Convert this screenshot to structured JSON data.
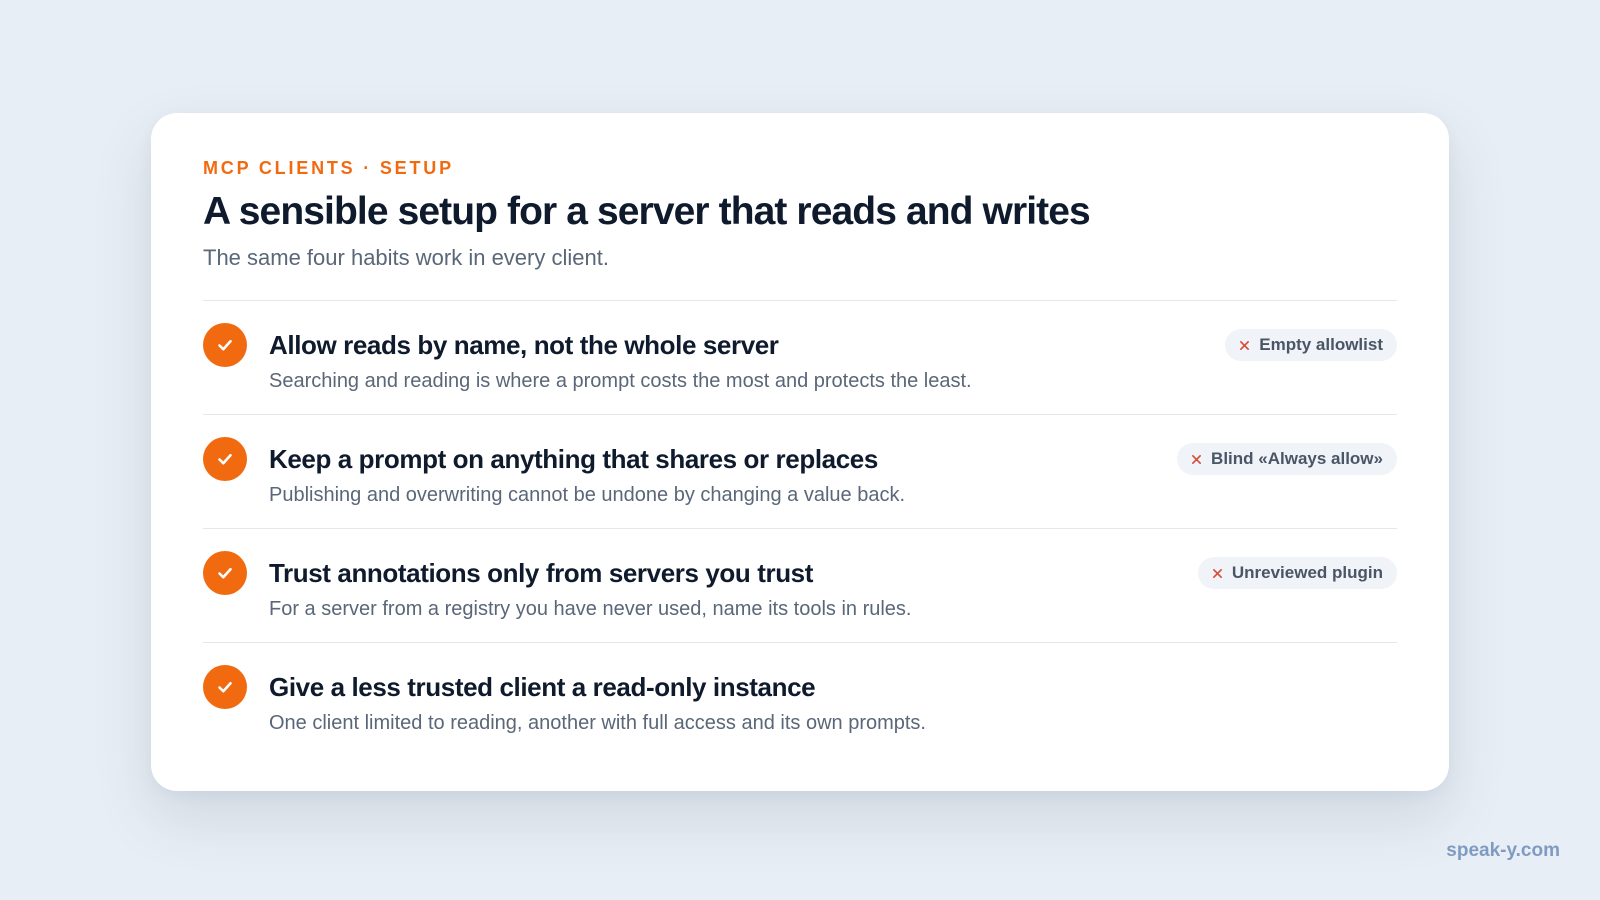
{
  "header": {
    "eyebrow": "MCP CLIENTS · SETUP",
    "title": "A sensible setup for a server that reads and writes",
    "subtitle": "The same four habits work in every client."
  },
  "items": [
    {
      "title": "Allow reads by name, not the whole server",
      "description": "Searching and reading is where a prompt costs the most and protects the least.",
      "badge": "Empty allowlist"
    },
    {
      "title": "Keep a prompt on anything that shares or replaces",
      "description": "Publishing and overwriting cannot be undone by changing a value back.",
      "badge": "Blind «Always allow»"
    },
    {
      "title": "Trust annotations only from servers you trust",
      "description": "For a server from a registry you have never used, name its tools in rules.",
      "badge": "Unreviewed plugin"
    },
    {
      "title": "Give a less trusted client a read-only instance",
      "description": "One client limited to reading, another with full access and its own prompts."
    }
  ],
  "footer": {
    "watermark": "speak-y.com"
  },
  "icons": {
    "check": "check-icon",
    "badge": "x-icon"
  },
  "colors": {
    "accent": "#f26a10",
    "background": "#e8eef5",
    "card": "#ffffff",
    "title": "#0f1b2d",
    "muted": "#5a6778",
    "badge_bg": "#f0f3f7",
    "badge_x": "#d94a3a",
    "watermark": "#7f9bc2"
  }
}
